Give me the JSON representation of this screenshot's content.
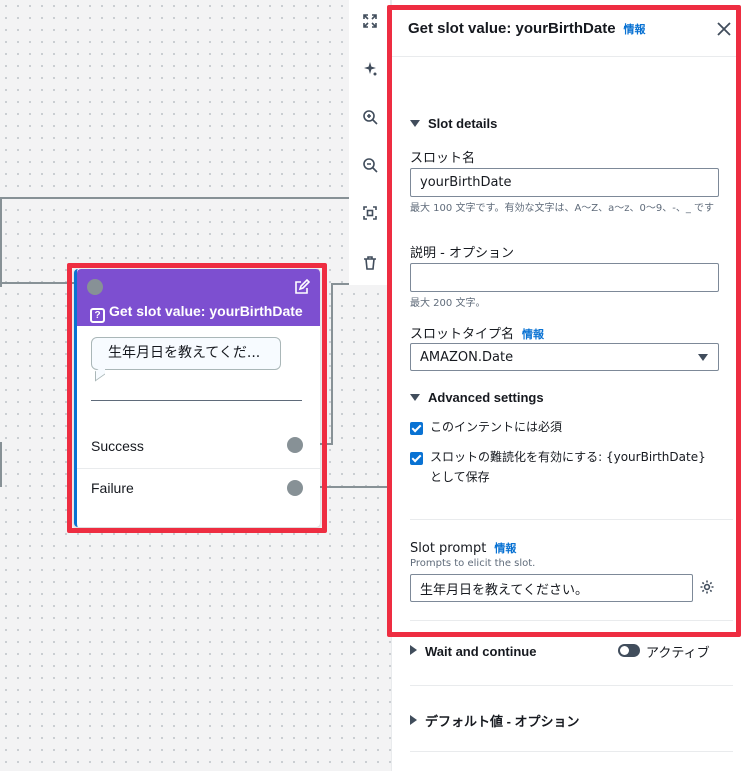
{
  "node": {
    "title": "Get slot value: yourBirthDate",
    "prompt_preview": "生年月日を教えてくだ...",
    "outcome_success": "Success",
    "outcome_failure": "Failure",
    "accent_color": "#7d4fd0"
  },
  "toolbar": {
    "tools": [
      "fullscreen-icon",
      "auto-layout-icon",
      "zoom-in-icon",
      "zoom-out-icon",
      "fit-view-icon",
      "delete-icon"
    ]
  },
  "panel": {
    "title": "Get slot value: yourBirthDate",
    "info": "情報",
    "slot_details": {
      "header": "Slot details",
      "name_label": "スロット名",
      "name_value": "yourBirthDate",
      "name_hint": "最大 100 文字です。有効な文字は、A〜Z、a〜z、0〜9、-、_ です",
      "desc_label": "説明 - オプション",
      "desc_value": "",
      "desc_hint": "最大 200 文字。",
      "type_label": "スロットタイプ名",
      "type_info": "情報",
      "type_value": "AMAZON.Date"
    },
    "advanced": {
      "header": "Advanced settings",
      "required_label": "このインテントには必須",
      "required_checked": true,
      "obfuscate_label": "スロットの難読化を有効にする: {yourBirthDate} として保存",
      "obfuscate_checked": true
    },
    "slot_prompt": {
      "label": "Slot prompt",
      "info": "情報",
      "hint": "Prompts to elicit the slot.",
      "value": "生年月日を教えてください。"
    },
    "wait_continue": {
      "header": "Wait and continue",
      "toggle_label": "アクティブ",
      "active": false
    },
    "default_values": {
      "header": "デフォルト値 - オプション"
    }
  }
}
